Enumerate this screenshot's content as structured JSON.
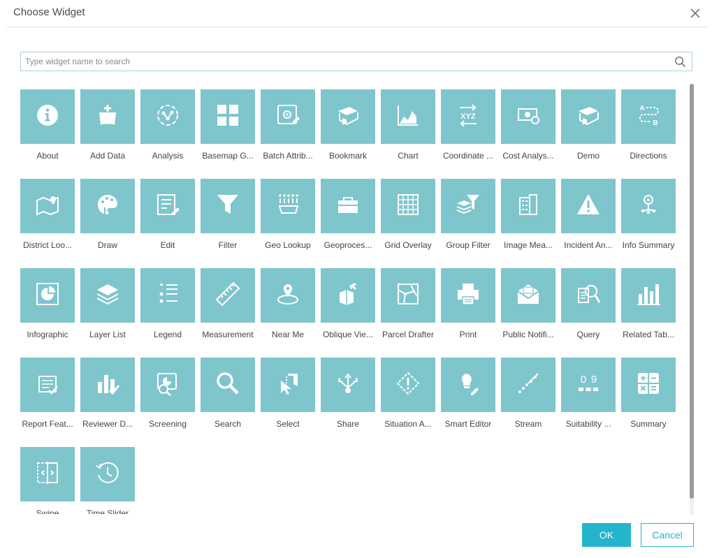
{
  "dialog": {
    "title": "Choose Widget",
    "close_icon": "close-icon"
  },
  "search": {
    "placeholder": "Type widget name to search",
    "value": "",
    "icon": "search-icon"
  },
  "colors": {
    "tile": "#7fc5cc",
    "primary": "#24b5cc"
  },
  "widgets": [
    {
      "label": "About",
      "icon": "info-icon"
    },
    {
      "label": "Add Data",
      "icon": "add-data-icon"
    },
    {
      "label": "Analysis",
      "icon": "analysis-icon"
    },
    {
      "label": "Basemap G...",
      "icon": "basemap-gallery-icon"
    },
    {
      "label": "Batch Attrib...",
      "icon": "batch-attribute-icon"
    },
    {
      "label": "Bookmark",
      "icon": "bookmark-icon"
    },
    {
      "label": "Chart",
      "icon": "chart-icon"
    },
    {
      "label": "Coordinate ...",
      "icon": "coordinate-icon"
    },
    {
      "label": "Cost Analys...",
      "icon": "cost-analysis-icon"
    },
    {
      "label": "Demo",
      "icon": "demo-icon"
    },
    {
      "label": "Directions",
      "icon": "directions-icon"
    },
    {
      "label": "District Loo...",
      "icon": "district-lookup-icon"
    },
    {
      "label": "Draw",
      "icon": "draw-icon"
    },
    {
      "label": "Edit",
      "icon": "edit-icon"
    },
    {
      "label": "Filter",
      "icon": "filter-icon"
    },
    {
      "label": "Geo Lookup",
      "icon": "geo-lookup-icon"
    },
    {
      "label": "Geoproces...",
      "icon": "geoprocessing-icon"
    },
    {
      "label": "Grid Overlay",
      "icon": "grid-overlay-icon"
    },
    {
      "label": "Group Filter",
      "icon": "group-filter-icon"
    },
    {
      "label": "Image Mea...",
      "icon": "image-measurement-icon"
    },
    {
      "label": "Incident An...",
      "icon": "incident-analysis-icon"
    },
    {
      "label": "Info Summary",
      "icon": "info-summary-icon"
    },
    {
      "label": "Infographic",
      "icon": "infographic-icon"
    },
    {
      "label": "Layer List",
      "icon": "layer-list-icon"
    },
    {
      "label": "Legend",
      "icon": "legend-icon"
    },
    {
      "label": "Measurement",
      "icon": "measurement-icon"
    },
    {
      "label": "Near Me",
      "icon": "near-me-icon"
    },
    {
      "label": "Oblique Vie...",
      "icon": "oblique-viewer-icon"
    },
    {
      "label": "Parcel Drafter",
      "icon": "parcel-drafter-icon"
    },
    {
      "label": "Print",
      "icon": "print-icon"
    },
    {
      "label": "Public Notifi...",
      "icon": "public-notification-icon"
    },
    {
      "label": "Query",
      "icon": "query-icon"
    },
    {
      "label": "Related Tab...",
      "icon": "related-table-icon"
    },
    {
      "label": "Report Feat...",
      "icon": "report-feature-icon"
    },
    {
      "label": "Reviewer D...",
      "icon": "reviewer-dashboard-icon"
    },
    {
      "label": "Screening",
      "icon": "screening-icon"
    },
    {
      "label": "Search",
      "icon": "search-widget-icon"
    },
    {
      "label": "Select",
      "icon": "select-icon"
    },
    {
      "label": "Share",
      "icon": "share-icon"
    },
    {
      "label": "Situation A...",
      "icon": "situation-awareness-icon"
    },
    {
      "label": "Smart Editor",
      "icon": "smart-editor-icon"
    },
    {
      "label": "Stream",
      "icon": "stream-icon"
    },
    {
      "label": "Suitability ...",
      "icon": "suitability-icon"
    },
    {
      "label": "Summary",
      "icon": "summary-icon"
    },
    {
      "label": "Swipe",
      "icon": "swipe-icon"
    },
    {
      "label": "Time Slider",
      "icon": "time-slider-icon"
    }
  ],
  "buttons": {
    "ok": "OK",
    "cancel": "Cancel"
  }
}
